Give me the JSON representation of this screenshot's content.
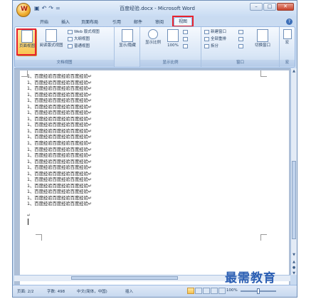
{
  "window": {
    "title": "百度经验.docx - Microsoft Word",
    "office_button_letter": "W"
  },
  "quick_access": {
    "save": "▣",
    "undo": "↶",
    "redo": "↷",
    "dropdown": "="
  },
  "window_controls": {
    "minimize": "–",
    "maximize": "□",
    "close": "✕"
  },
  "tabs": [
    "开始",
    "插入",
    "页面布局",
    "引用",
    "邮件",
    "审阅",
    "视图"
  ],
  "active_tab": "视图",
  "ribbon": {
    "groups": {
      "doc_views": {
        "label": "文档视图",
        "page_view": "页面视图",
        "reading_view": "阅读版式视图",
        "web_view": "Web 版式视图",
        "outline_view": "大纲视图",
        "draft_view": "普通视图"
      },
      "show_hide": {
        "label": "显示/隐藏"
      },
      "zoom": {
        "label": "显示比例",
        "zoom_btn": "显示比例",
        "percent": "100%"
      },
      "window": {
        "label": "窗口",
        "new_window": "新建窗口",
        "arrange_all": "全部重排",
        "split": "拆分",
        "switch_windows": "切换窗口"
      },
      "macros": {
        "label": "宏",
        "btn": "宏"
      }
    }
  },
  "document": {
    "lines": [
      "1、百度经验百度经验百度经验↵",
      "1、百度经验百度经验百度经验↵",
      "1、百度经验百度经验百度经验↵",
      "1、百度经验百度经验百度经验↵",
      "1、百度经验百度经验百度经验↵",
      "1、百度经验百度经验百度经验↵",
      "1、百度经验百度经验百度经验↵",
      "1、百度经验百度经验百度经验↵",
      "1、百度经验百度经验百度经验↵",
      "1、百度经验百度经验百度经验↵",
      "1、百度经验百度经验百度经验↵",
      "1、百度经验百度经验百度经验↵",
      "1、百度经验百度经验百度经验↵",
      "1、百度经验百度经验百度经验↵",
      "1、百度经验百度经验百度经验↵",
      "1、百度经验百度经验百度经验↵",
      "1、百度经验百度经验百度经验↵",
      "1、百度经验百度经验百度经验↵",
      "1、百度经验百度经验百度经验↵",
      "1、百度经验百度经验百度经验↵",
      "1、百度经验百度经验百度经验↵",
      "1、百度经验百度经验百度经验↵"
    ],
    "paragraph_mark": "↵"
  },
  "status_bar": {
    "page": "页面: 2/2",
    "words": "字数: 498",
    "language": "中文(简体，中国)",
    "mode": "插入",
    "zoom": "100%"
  },
  "watermark": "最需教育"
}
